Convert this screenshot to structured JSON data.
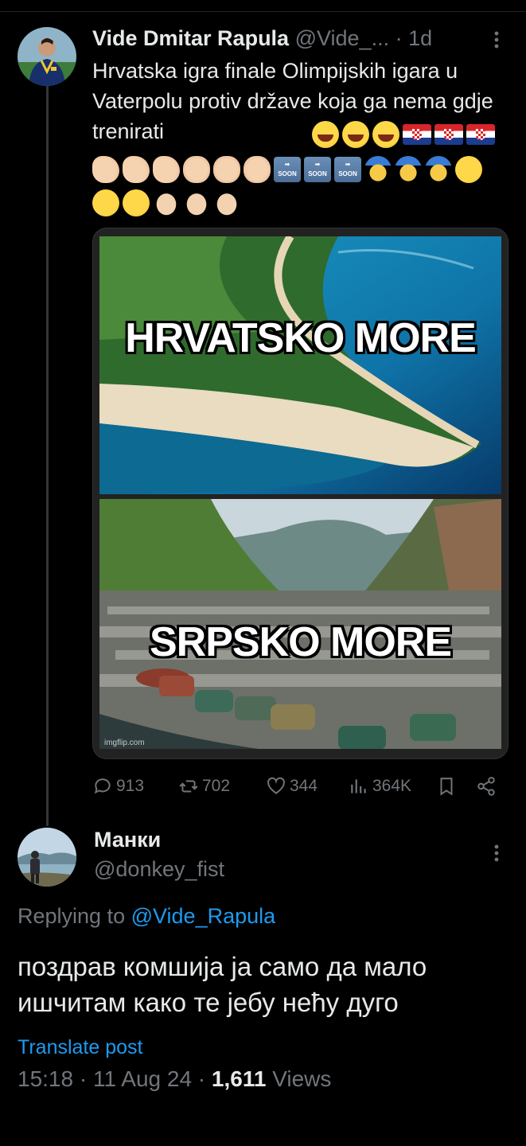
{
  "tweet": {
    "author_name": "Vide Dmitar Rapula",
    "author_handle": "@Vide_...",
    "separator": "·",
    "time": "1d",
    "text": "Hrvatska igra finale Olimpijskih igara u Vaterpolu protiv države koja ga nema gdje trenirati",
    "emoji_icons": [
      "rolling-laughing-icon",
      "rolling-laughing-icon",
      "rolling-laughing-icon",
      "croatia-flag-icon",
      "croatia-flag-icon",
      "croatia-flag-icon",
      "flexed-biceps-icon",
      "flexed-biceps-icon",
      "flexed-biceps-icon",
      "fist-bump-icon",
      "fist-bump-icon",
      "fist-bump-icon",
      "soon-arrow-icon",
      "soon-arrow-icon",
      "soon-arrow-icon",
      "gold-medal-icon",
      "gold-medal-icon",
      "gold-medal-icon",
      "saluting-face-icon",
      "saluting-face-icon",
      "saluting-face-icon",
      "folded-hands-icon",
      "folded-hands-icon",
      "folded-hands-icon"
    ],
    "meme": {
      "top_caption": "HRVATSKO MORE",
      "bottom_caption": "SRPSKO MORE",
      "watermark": "imgflip.com"
    },
    "stats": {
      "replies": "913",
      "reposts": "702",
      "likes": "344",
      "views": "364K"
    }
  },
  "reply": {
    "author_name": "Манки",
    "author_handle": "@donkey_fist",
    "replying_label": "Replying to",
    "replying_to": "@Vide_Rapula",
    "text": "поздрав комшија ја само да мало ишчитам како те јебу нећу дуго",
    "translate_label": "Translate post",
    "time": "15:18",
    "date": "11 Aug 24",
    "separator": "·",
    "views_count": "1,611",
    "views_label": "Views"
  },
  "colors": {
    "background": "#000000",
    "text_primary": "#e7e9ea",
    "text_secondary": "#71767b",
    "accent": "#1d9bf0"
  }
}
